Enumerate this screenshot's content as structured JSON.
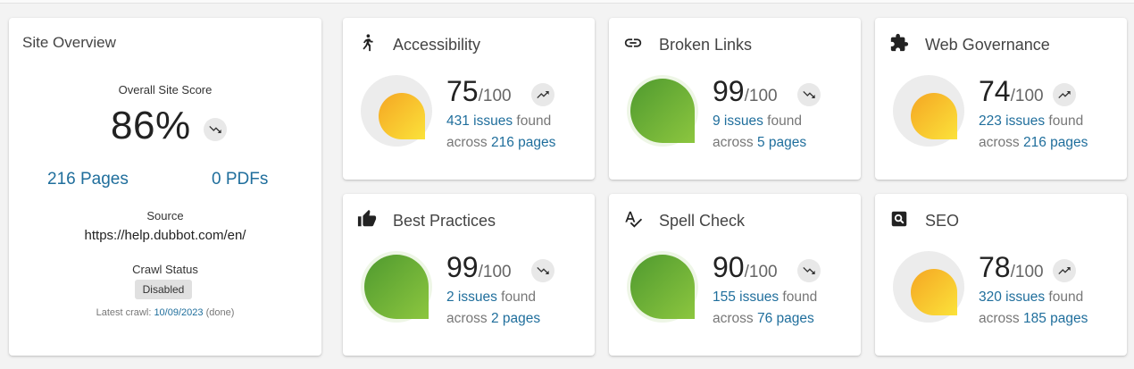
{
  "overview": {
    "title": "Site Overview",
    "score_label": "Overall Site Score",
    "score": "86%",
    "trend": "trending-down",
    "pages": "216 Pages",
    "pdfs": "0 PDFs",
    "source_label": "Source",
    "source_url": "https://help.dubbot.com/en/",
    "crawl_status_label": "Crawl Status",
    "crawl_status": "Disabled",
    "latest_crawl_label": "Latest crawl:",
    "latest_crawl_date": "10/09/2023",
    "latest_crawl_state": "(done)"
  },
  "metrics": [
    {
      "title": "Accessibility",
      "icon": "accessibility-icon",
      "score": "75",
      "of": "/100",
      "trend": "trending-up",
      "issues": "431 issues",
      "found": " found",
      "across": "across ",
      "pages": "216 pages",
      "level": 0.75
    },
    {
      "title": "Broken Links",
      "icon": "link-icon",
      "score": "99",
      "of": "/100",
      "trend": "trending-down",
      "issues": "9 issues",
      "found": " found",
      "across": "across ",
      "pages": "5 pages",
      "level": 0.99
    },
    {
      "title": "Web Governance",
      "icon": "puzzle-icon",
      "score": "74",
      "of": "/100",
      "trend": "trending-up",
      "issues": "223 issues",
      "found": " found",
      "across": "across ",
      "pages": "216 pages",
      "level": 0.74
    },
    {
      "title": "Best Practices",
      "icon": "thumbs-up-icon",
      "score": "99",
      "of": "/100",
      "trend": "trending-down",
      "issues": "2 issues",
      "found": " found",
      "across": "across ",
      "pages": "2 pages",
      "level": 0.99
    },
    {
      "title": "Spell Check",
      "icon": "spellcheck-icon",
      "score": "90",
      "of": "/100",
      "trend": "trending-down",
      "issues": "155 issues",
      "found": " found",
      "across": "across ",
      "pages": "76 pages",
      "level": 0.9
    },
    {
      "title": "SEO",
      "icon": "seo-search-icon",
      "score": "78",
      "of": "/100",
      "trend": "trending-up",
      "issues": "320 issues",
      "found": " found",
      "across": "across ",
      "pages": "185 pages",
      "level": 0.78
    }
  ],
  "colors": {
    "link_blue": "#1f6e9c",
    "good_green": "#6fb33a",
    "warn_orange": "#f5a623",
    "warn_yellow": "#fbe23a"
  }
}
